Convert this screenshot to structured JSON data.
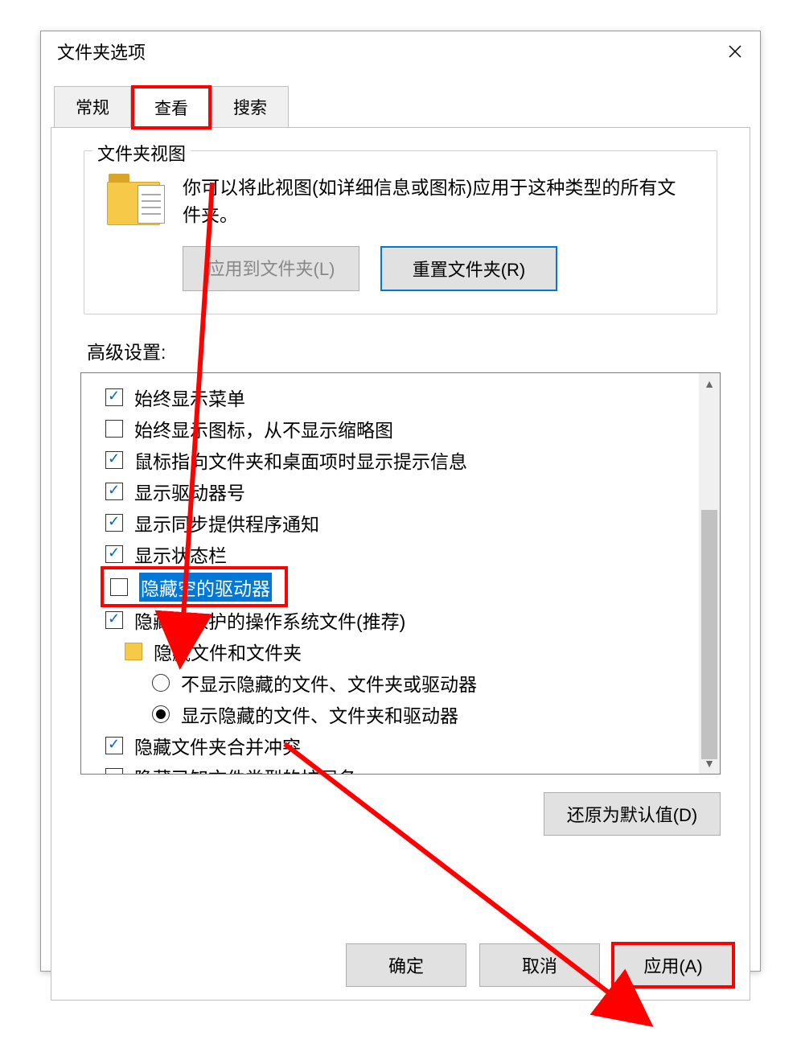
{
  "title": "文件夹选项",
  "tabs": {
    "general": "常规",
    "view": "查看",
    "search": "搜索"
  },
  "groupbox": {
    "legend": "文件夹视图",
    "desc": "你可以将此视图(如详细信息或图标)应用于这种类型的所有文件夹。",
    "apply_btn": "应用到文件夹(L)",
    "reset_btn": "重置文件夹(R)"
  },
  "adv_label": "高级设置:",
  "options": [
    {
      "kind": "check",
      "checked": true,
      "label": "始终显示菜单"
    },
    {
      "kind": "check",
      "checked": false,
      "label": "始终显示图标，从不显示缩略图"
    },
    {
      "kind": "check",
      "checked": true,
      "label": "鼠标指向文件夹和桌面项时显示提示信息"
    },
    {
      "kind": "check",
      "checked": true,
      "label": "显示驱动器号"
    },
    {
      "kind": "check",
      "checked": true,
      "label": "显示同步提供程序通知"
    },
    {
      "kind": "check",
      "checked": true,
      "label": "显示状态栏"
    },
    {
      "kind": "check",
      "checked": false,
      "label": "隐藏空的驱动器",
      "highlight": true
    },
    {
      "kind": "check",
      "checked": true,
      "label": "隐藏受保护的操作系统文件(推荐)"
    },
    {
      "kind": "folder",
      "label": "隐藏文件和文件夹"
    },
    {
      "kind": "radio",
      "checked": false,
      "label": "不显示隐藏的文件、文件夹或驱动器",
      "indent": 2
    },
    {
      "kind": "radio",
      "checked": true,
      "label": "显示隐藏的文件、文件夹和驱动器",
      "indent": 2
    },
    {
      "kind": "check",
      "checked": true,
      "label": "隐藏文件夹合并冲突"
    },
    {
      "kind": "check",
      "checked": false,
      "label": "隐藏已知文件类型的扩展名"
    }
  ],
  "restore_btn": "还原为默认值(D)",
  "ok_btn": "确定",
  "cancel_btn": "取消",
  "apply_btn": "应用(A)"
}
